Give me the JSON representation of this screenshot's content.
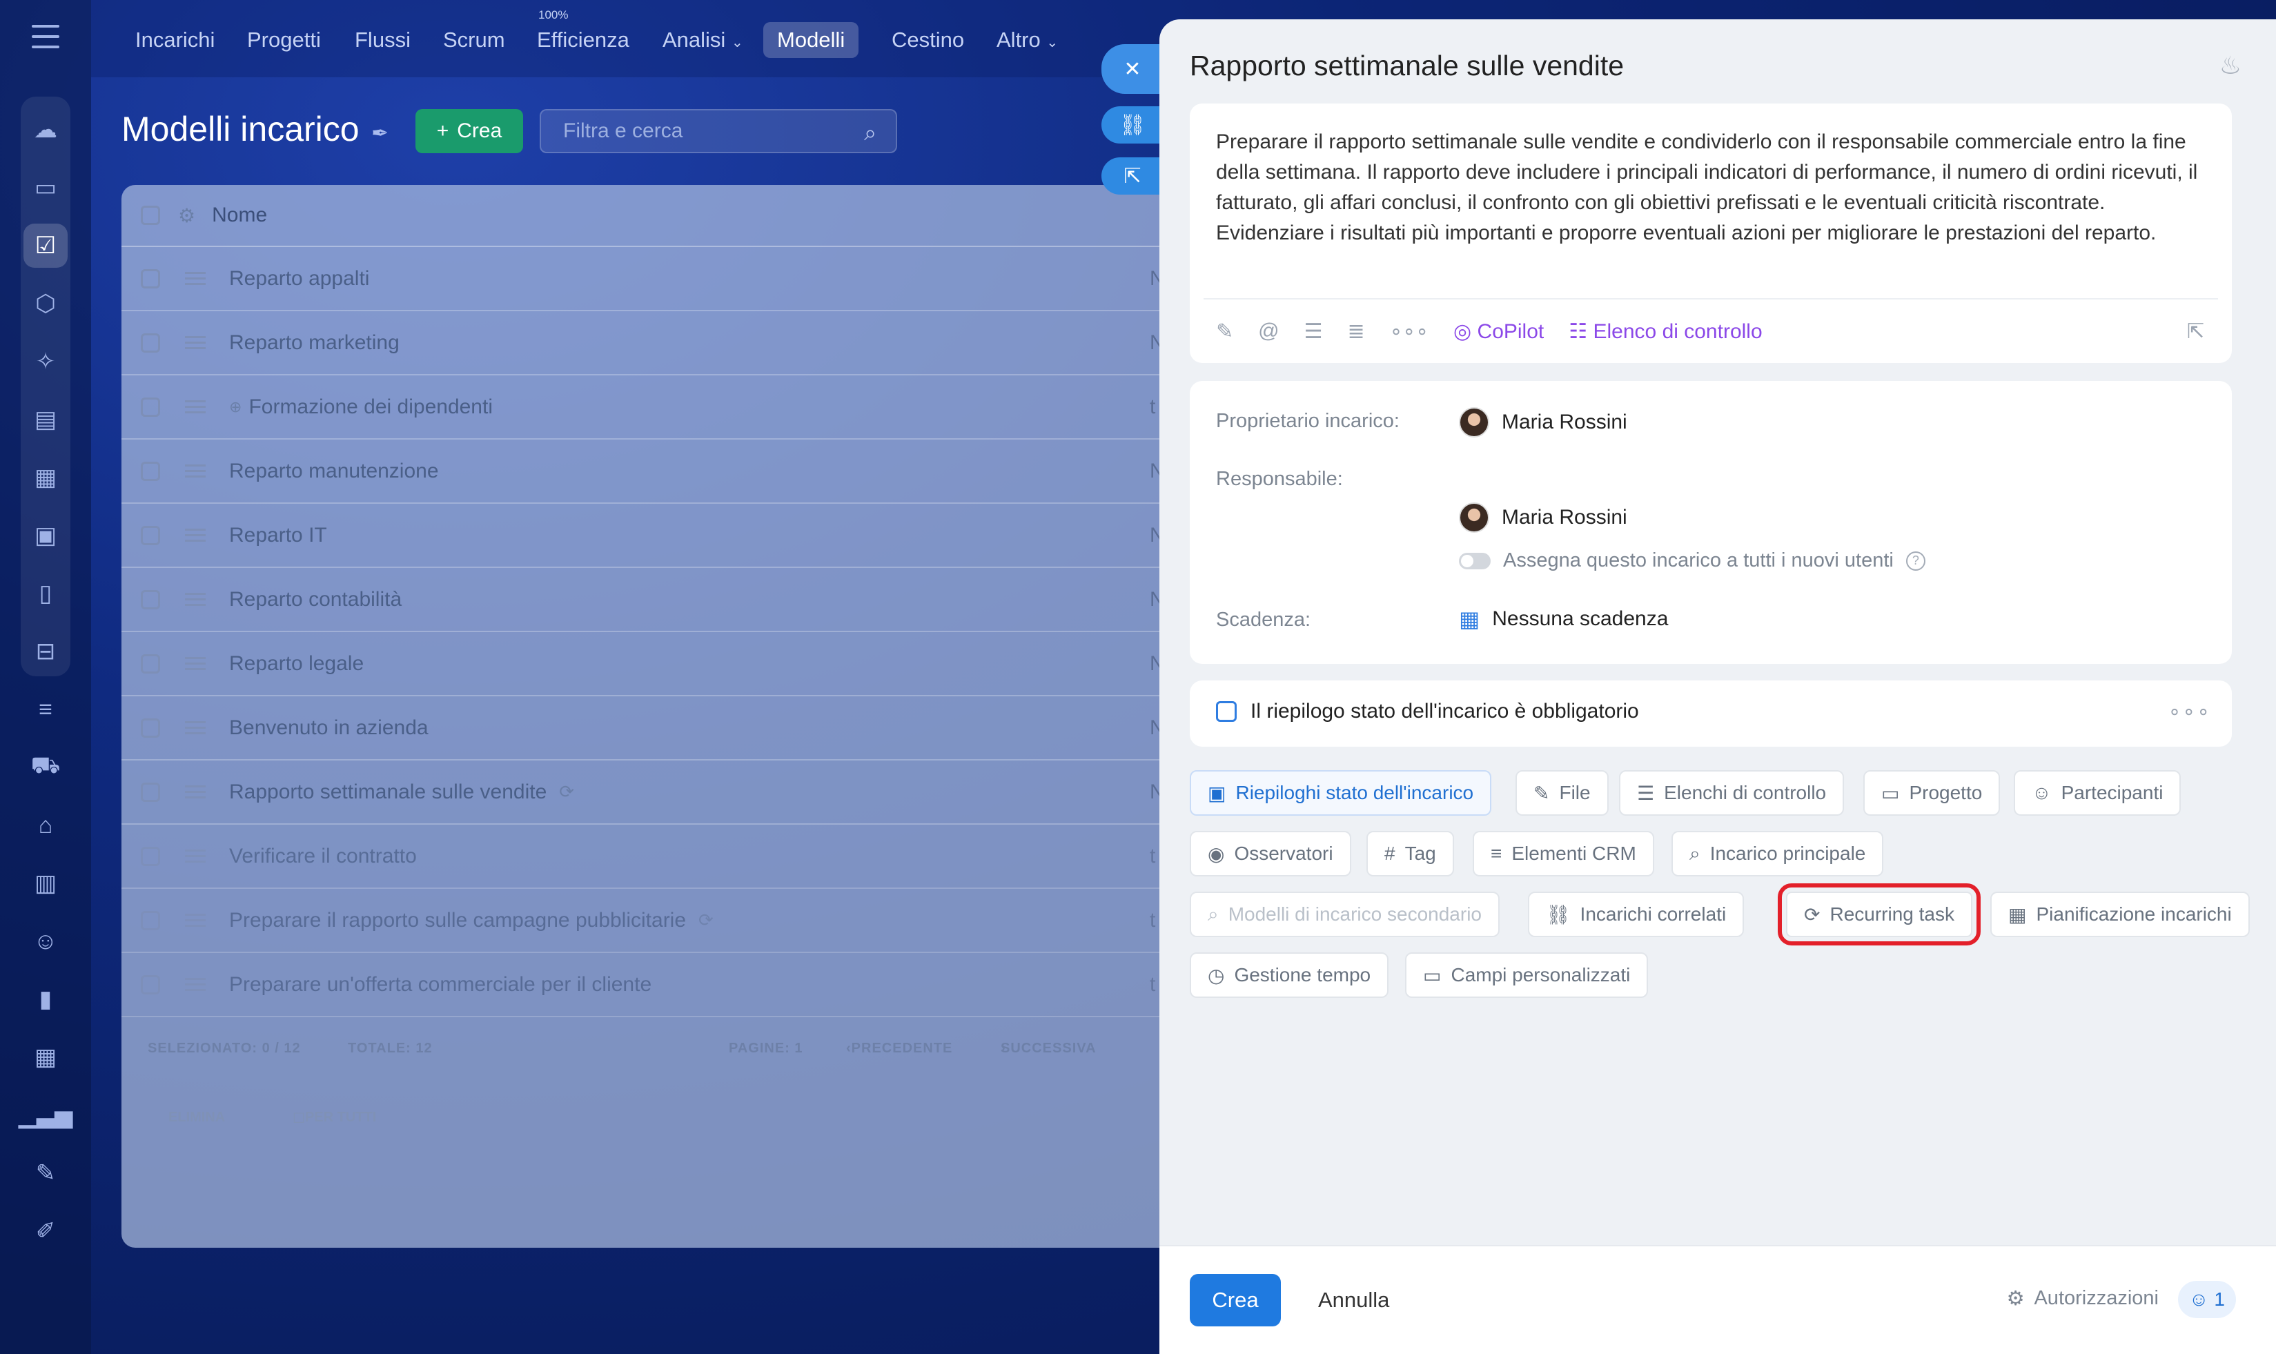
{
  "nav": {
    "items": [
      "Incarichi",
      "Progetti",
      "Flussi",
      "Scrum",
      "Efficienza",
      "Analisi",
      "Modelli",
      "Cestino",
      "Altro"
    ],
    "efficienza_badge": "100%"
  },
  "page": {
    "title": "Modelli incarico",
    "create_label": "Crea",
    "search_placeholder": "Filtra e cerca"
  },
  "table": {
    "header_name": "Nome",
    "rows": [
      "Reparto appalti",
      "Reparto marketing",
      "Formazione dei dipendenti",
      "Reparto manutenzione",
      "Reparto IT",
      "Reparto contabilità",
      "Reparto legale",
      "Benvenuto in azienda",
      "Rapporto settimanale sulle vendite",
      "Verificare il contratto",
      "Preparare il rapporto sulle campagne pubblicitarie",
      "Preparare un'offerta commerciale per il cliente"
    ],
    "footer": {
      "selected": "SELEZIONATO: 0 / 12",
      "total": "TOTALE: 12",
      "pages": "PAGINE: 1",
      "prev": "PRECEDENTE",
      "next": "SUCCESSIVA",
      "delete": "ELIMINA",
      "for_all": "PER TUTTI"
    }
  },
  "panel": {
    "title": "Rapporto settimanale sulle vendite",
    "description": "Preparare il rapporto settimanale sulle vendite e condividerlo con il responsabile commerciale entro la fine della settimana. Il rapporto deve includere i principali indicatori di performance, il numero di ordini ricevuti, il fatturato, gli affari conclusi, il confronto con gli obiettivi prefissati e le eventuali criticità riscontrate. Evidenziare i risultati più importanti e proporre eventuali azioni per migliorare le prestazioni del reparto.",
    "copilot": "CoPilot",
    "checklist": "Elenco di controllo",
    "owner_label": "Proprietario incarico:",
    "owner_name": "Maria Rossini",
    "responsible_label": "Responsabile:",
    "responsible_name": "Maria Rossini",
    "assign_all": "Assegna questo incarico a tutti i nuovi utenti",
    "deadline_label": "Scadenza:",
    "deadline_value": "Nessuna scadenza",
    "summary_required": "Il riepilogo stato dell'incarico è obbligatorio",
    "chips": [
      "Riepiloghi stato dell'incarico",
      "File",
      "Elenchi di controllo",
      "Progetto",
      "Partecipanti",
      "Osservatori",
      "Tag",
      "Elementi CRM",
      "Incarico principale",
      "Modelli di incarico secondario",
      "Incarichi correlati",
      "Recurring task",
      "Pianificazione incarichi",
      "Gestione tempo",
      "Campi personalizzati"
    ],
    "footer": {
      "create": "Crea",
      "cancel": "Annulla",
      "permissions": "Autorizzazioni",
      "count": "1"
    }
  }
}
